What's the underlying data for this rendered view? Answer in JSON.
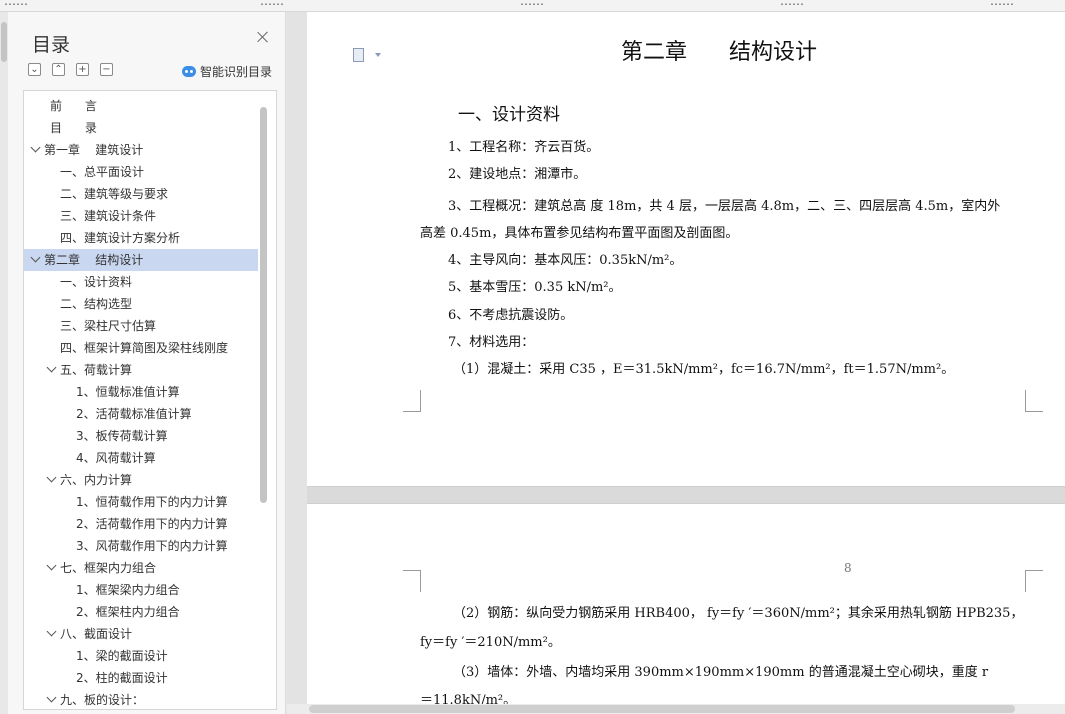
{
  "toolbar_fragments": [
    "……",
    "……",
    "……",
    "……",
    "……"
  ],
  "toc": {
    "title": "目录",
    "smart_label": "智能识别目录",
    "tool_buttons": [
      "⌄",
      "⌃",
      "+",
      "−"
    ],
    "items": [
      {
        "label": "前      言",
        "level": 0,
        "chevron": false
      },
      {
        "label": "目      录",
        "level": 0,
        "chevron": false
      },
      {
        "label": "第一章    建筑设计",
        "level": 0,
        "chevron": true
      },
      {
        "label": "一、总平面设计",
        "level": 1,
        "chevron": false
      },
      {
        "label": "二、建筑等级与要求",
        "level": 1,
        "chevron": false
      },
      {
        "label": "三、建筑设计条件",
        "level": 1,
        "chevron": false
      },
      {
        "label": "四、建筑设计方案分析",
        "level": 1,
        "chevron": false
      },
      {
        "label": "第二章    结构设计",
        "level": 0,
        "chevron": true,
        "selected": true
      },
      {
        "label": "一、设计资料",
        "level": 1,
        "chevron": false
      },
      {
        "label": "二、结构选型",
        "level": 1,
        "chevron": false
      },
      {
        "label": "三、梁柱尺寸估算",
        "level": 1,
        "chevron": false
      },
      {
        "label": "四、框架计算简图及梁柱线刚度",
        "level": 1,
        "chevron": false
      },
      {
        "label": "五、荷载计算",
        "level": 1,
        "chevron": true
      },
      {
        "label": "1、恒载标准值计算",
        "level": 2,
        "chevron": false
      },
      {
        "label": "2、活荷载标准值计算",
        "level": 2,
        "chevron": false
      },
      {
        "label": "3、板传荷载计算",
        "level": 2,
        "chevron": false
      },
      {
        "label": "4、风荷载计算",
        "level": 2,
        "chevron": false
      },
      {
        "label": "六、内力计算",
        "level": 1,
        "chevron": true
      },
      {
        "label": "1、恒荷载作用下的内力计算",
        "level": 2,
        "chevron": false
      },
      {
        "label": "2、活荷载作用下的内力计算",
        "level": 2,
        "chevron": false
      },
      {
        "label": "3、风荷载作用下的内力计算",
        "level": 2,
        "chevron": false
      },
      {
        "label": "七、框架内力组合",
        "level": 1,
        "chevron": true
      },
      {
        "label": "1、框架梁内力组合",
        "level": 2,
        "chevron": false
      },
      {
        "label": "2、框架柱内力组合",
        "level": 2,
        "chevron": false
      },
      {
        "label": "八、截面设计",
        "level": 1,
        "chevron": true
      },
      {
        "label": "1、梁的截面设计",
        "level": 2,
        "chevron": false
      },
      {
        "label": "2、柱的截面设计",
        "level": 2,
        "chevron": false
      },
      {
        "label": "九、板的设计：",
        "level": 1,
        "chevron": true
      }
    ]
  },
  "doc": {
    "chapter_title": "第二章      结构设计",
    "section_title": "一、设计资料",
    "page1_lines": [
      "1、工程名称：齐云百货。",
      "2、建设地点：湘潭市。",
      "3、工程概况：建筑总高   度 18m，共 4 层，一层层高 4.8m，二、三、四层层高 4.5m，室内外",
      "高差 0.45m，具体布置参见结构布置平面图及剖面图。",
      "4、主导风向：基本风压：0.35kN/m²。",
      "5、基本雪压：0.35 kN/m²。",
      "6、不考虑抗震设防。",
      "7、材料选用：",
      "（1）混凝土：采用 C35 ，E＝31.5kN/mm²，fc＝16.7N/mm²，ft＝1.57N/mm²。"
    ],
    "page_number": "8",
    "page2_lines": [
      "（2）钢筋：纵向受力钢筋采用 HRB400，  fy＝fy ′＝360N/mm²；其余采用热轧钢筋 HPB235，",
      "fy＝fy ′＝210N/mm²。",
      "（3）墙体：外墙、内墙均采用 390mm×190mm×190mm 的普通混凝土空心砌块，重度 r",
      "＝11.8kN/m²。"
    ]
  }
}
